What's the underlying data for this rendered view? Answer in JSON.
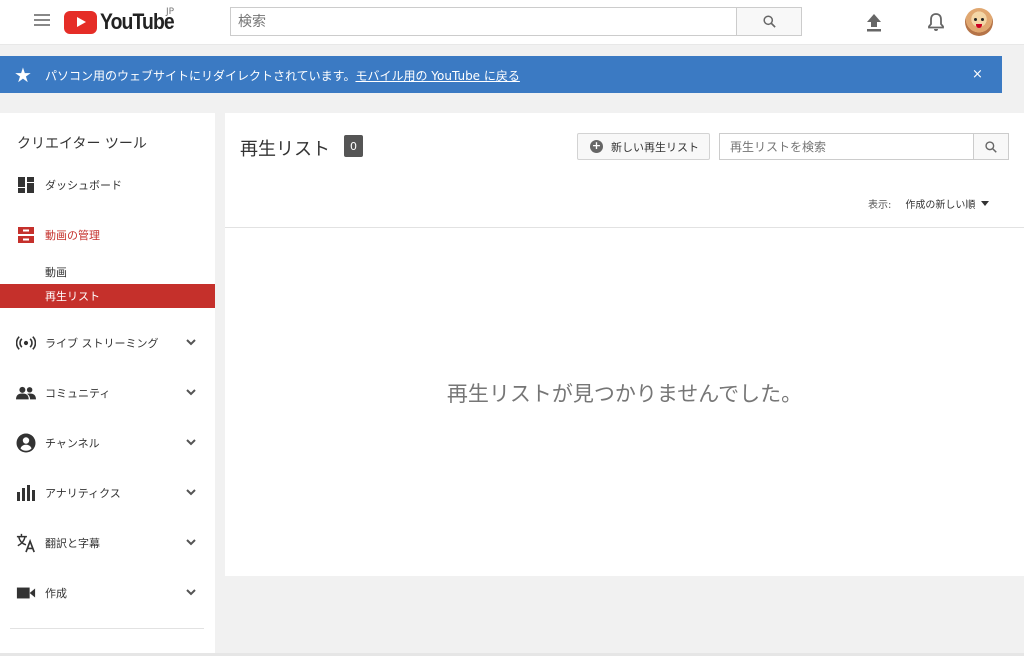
{
  "header": {
    "logo_text": "YouTube",
    "logo_region": "JP",
    "search_placeholder": "検索"
  },
  "banner": {
    "message": "パソコン用のウェブサイトにリダイレクトされています。",
    "link": "モバイル用の YouTube に戻る",
    "close": "×"
  },
  "sidebar": {
    "title": "クリエイター ツール",
    "dashboard": "ダッシュボード",
    "video_manager": "動画の管理",
    "sub_videos": "動画",
    "sub_playlists": "再生リスト",
    "live": "ライブ ストリーミング",
    "community": "コミュニティ",
    "channel": "チャンネル",
    "analytics": "アナリティクス",
    "translation": "翻訳と字幕",
    "create": "作成"
  },
  "main": {
    "title": "再生リスト",
    "count": "0",
    "new_playlist": "新しい再生リスト",
    "search_placeholder": "再生リストを検索",
    "sort_label": "表示:",
    "sort_value": "作成の新しい順",
    "empty_message": "再生リストが見つかりませんでした。"
  },
  "colors": {
    "brand_red": "#e52d27",
    "banner_blue": "#3b7ac3",
    "active_red": "#c5302b"
  }
}
